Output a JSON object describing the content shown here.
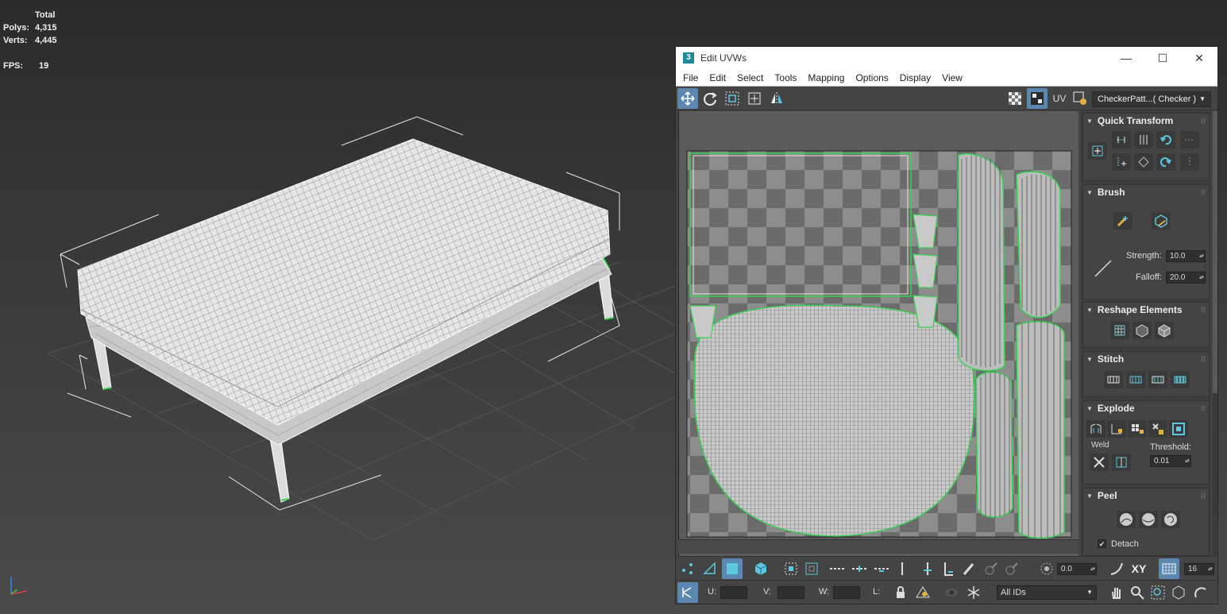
{
  "scene_stats": {
    "header": "Total",
    "polys_label": "Polys:",
    "polys_value": "4,315",
    "verts_label": "Verts:",
    "verts_value": "4,445",
    "fps_label": "FPS:",
    "fps_value": "19"
  },
  "window": {
    "app_badge": "3",
    "title": "Edit UVWs",
    "minimize": "—",
    "maximize": "☐",
    "close": "✕"
  },
  "menu": [
    "File",
    "Edit",
    "Select",
    "Tools",
    "Mapping",
    "Options",
    "Display",
    "View"
  ],
  "top_toolbar": {
    "uv_label": "UV",
    "texture_dropdown": "CheckerPatt...( Checker )"
  },
  "rollouts": {
    "quick_transform": {
      "title": "Quick Transform"
    },
    "brush": {
      "title": "Brush",
      "strength_label": "Strength:",
      "strength_value": "10.0",
      "falloff_label": "Falloff:",
      "falloff_value": "20.0"
    },
    "reshape": {
      "title": "Reshape Elements"
    },
    "stitch": {
      "title": "Stitch"
    },
    "explode": {
      "title": "Explode",
      "weld_label": "Weld",
      "threshold_label": "Threshold:",
      "threshold_value": "0.01"
    },
    "peel": {
      "title": "Peel",
      "detach_label": "Detach"
    }
  },
  "bottom_toolbar": {
    "angle_value": "0.0",
    "xy_label": "XY",
    "grid_value": "16",
    "u_label": "U:",
    "v_label": "V:",
    "w_label": "W:",
    "l_label": "L:",
    "ids_dropdown": "All IDs"
  },
  "colors": {
    "accent_selection": "#39d353",
    "active_button": "#5b87b0",
    "checker_dark": "#6b6b6b",
    "checker_light": "#8d8d8d"
  }
}
